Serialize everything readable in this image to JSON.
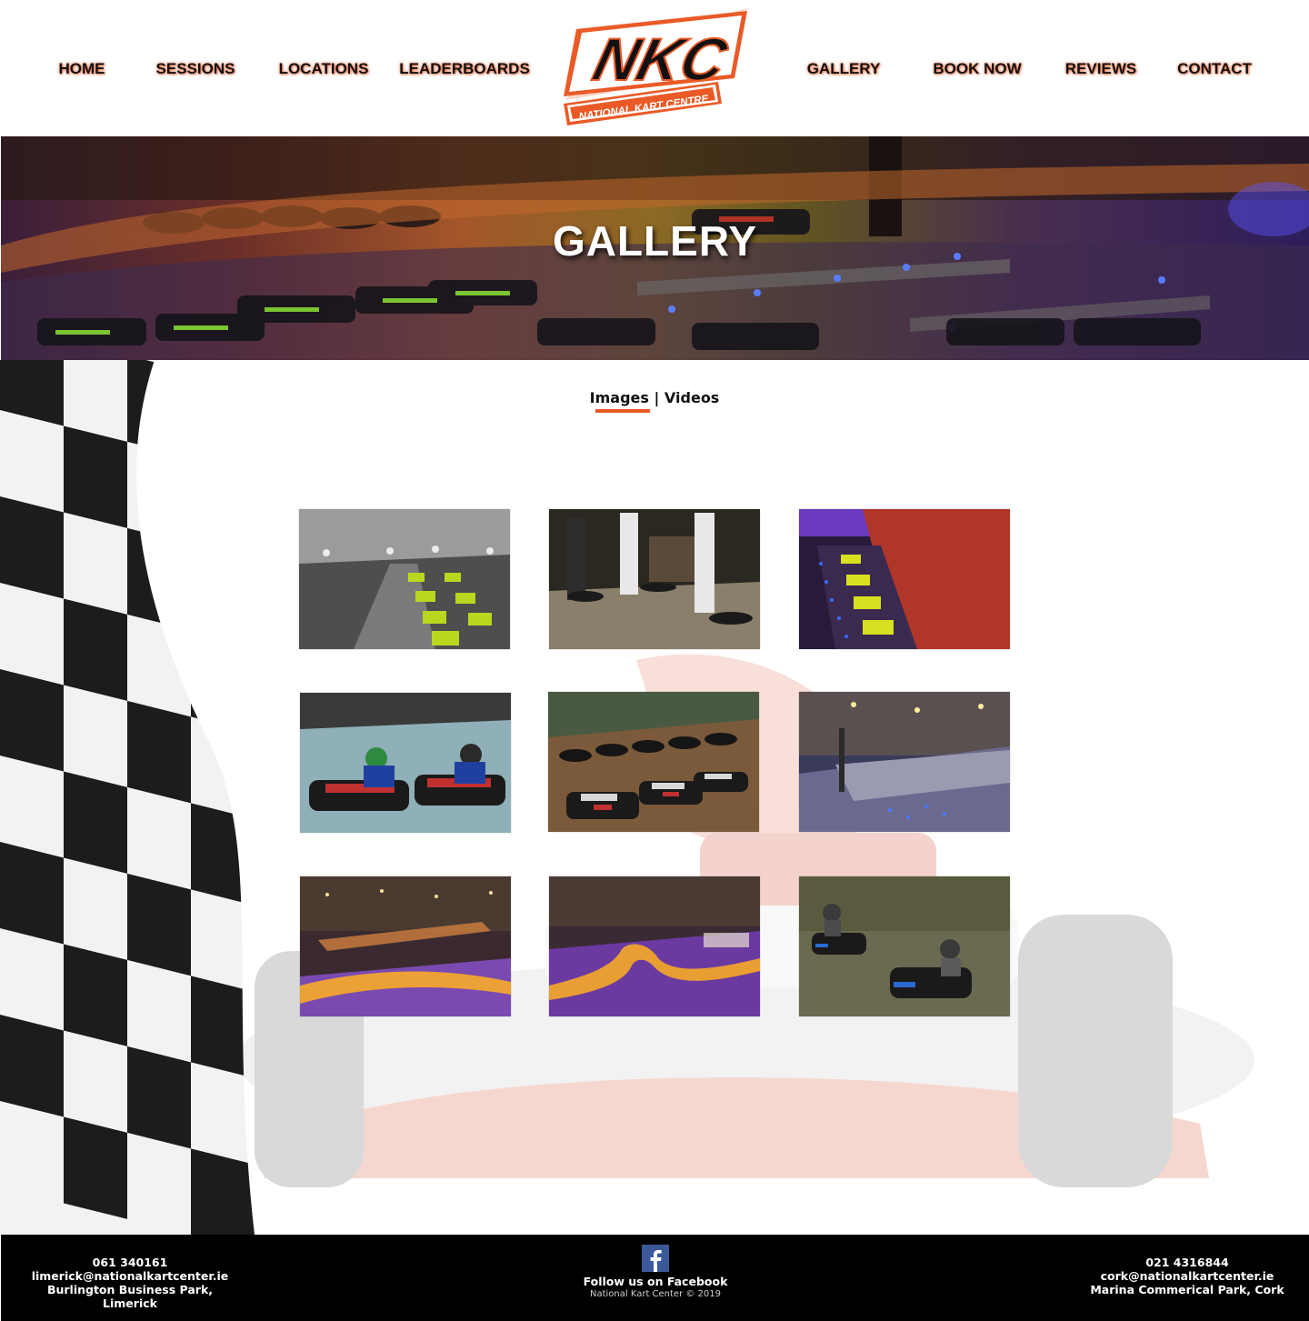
{
  "nav": {
    "left": [
      "HOME",
      "SESSIONS",
      "LOCATIONS",
      "LEADERBOARDS"
    ],
    "right": [
      "GALLERY",
      "BOOK NOW",
      "REVIEWS",
      "CONTACT"
    ]
  },
  "logo": {
    "text": "NKC",
    "tagline": "NATIONAL KART CENTRE",
    "icon": "nkc-logo-icon"
  },
  "hero": {
    "title": "GALLERY"
  },
  "tabs": {
    "images": "Images",
    "separator": "|",
    "videos": "Videos",
    "active": "Images"
  },
  "gallery": {
    "items": [
      {
        "name": "gallery-image-1"
      },
      {
        "name": "gallery-image-2"
      },
      {
        "name": "gallery-image-3"
      },
      {
        "name": "gallery-image-4"
      },
      {
        "name": "gallery-image-5"
      },
      {
        "name": "gallery-image-6"
      },
      {
        "name": "gallery-image-7"
      },
      {
        "name": "gallery-image-8"
      },
      {
        "name": "gallery-image-9"
      }
    ]
  },
  "footer": {
    "left": {
      "phone": "061 340161",
      "email": "limerick@nationalkartcenter.ie",
      "address": "Burlington Business Park, Limerick"
    },
    "center": {
      "facebook_icon": "facebook-icon",
      "facebook_label": "Follow us on Facebook",
      "copyright": "National Kart Center © 2019"
    },
    "right": {
      "phone": "021 4316844",
      "email": "cork@nationalkartcenter.ie",
      "address": "Marina Commerical Park, Cork"
    }
  },
  "colors": {
    "accent": "#ea5a26",
    "text": "#111111",
    "footer_bg": "#000000",
    "facebook": "#3b5998"
  }
}
